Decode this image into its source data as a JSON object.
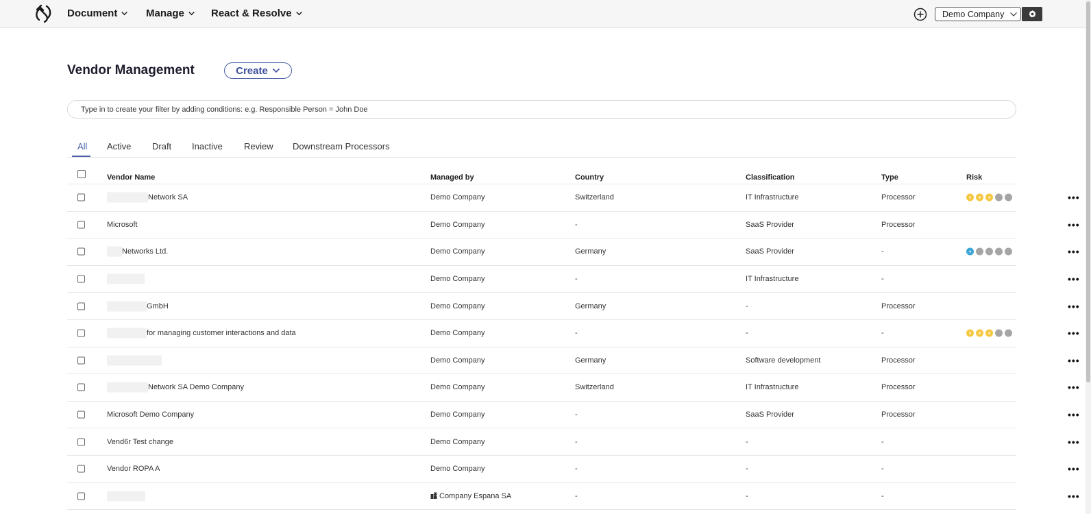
{
  "nav": {
    "items": [
      "Document",
      "Manage",
      "React & Resolve"
    ],
    "company": "Demo Company"
  },
  "page": {
    "title": "Vendor Management",
    "create_label": "Create",
    "filter_placeholder": "Type in to create your filter by adding conditions: e.g. Responsible Person = John Doe"
  },
  "tabs": [
    "All",
    "Active",
    "Draft",
    "Inactive",
    "Review",
    "Downstream Processors"
  ],
  "active_tab": "All",
  "table": {
    "headers": [
      "Vendor Name",
      "Managed by",
      "Country",
      "Classification",
      "Type",
      "Risk"
    ],
    "rows": [
      {
        "name": "Network SA",
        "managed": "Demo Company",
        "country": "Switzerland",
        "classification": "IT Infrastructure",
        "type": "Processor",
        "risk": {
          "level": 3,
          "color": "#f5c842"
        }
      },
      {
        "name": "Microsoft",
        "managed": "Demo Company",
        "country": "-",
        "classification": "SaaS Provider",
        "type": "Processor",
        "risk": null
      },
      {
        "name": "Networks Ltd.",
        "managed": "Demo Company",
        "country": "Germany",
        "classification": "SaaS Provider",
        "type": "-",
        "risk": {
          "level": 1,
          "color": "#3aa6d8"
        }
      },
      {
        "name": "",
        "managed": "Demo Company",
        "country": "-",
        "classification": "IT Infrastructure",
        "type": "-",
        "risk": null
      },
      {
        "name": "GmbH",
        "managed": "Demo Company",
        "country": "Germany",
        "classification": "-",
        "type": "Processor",
        "risk": null
      },
      {
        "name": "for managing customer interactions and data",
        "managed": "Demo Company",
        "country": "-",
        "classification": "-",
        "type": "-",
        "risk": {
          "level": 3,
          "color": "#f5c842"
        }
      },
      {
        "name": "",
        "managed": "Demo Company",
        "country": "Germany",
        "classification": "Software development",
        "type": "Processor",
        "risk": null
      },
      {
        "name": "Network SA Demo Company",
        "managed": "Demo Company",
        "country": "Switzerland",
        "classification": "IT Infrastructure",
        "type": "Processor",
        "risk": null
      },
      {
        "name": "Microsoft Demo Company",
        "managed": "Demo Company",
        "country": "-",
        "classification": "SaaS Provider",
        "type": "Processor",
        "risk": null
      },
      {
        "name": "Vend6r Test change",
        "managed": "Demo Company",
        "country": "-",
        "classification": "-",
        "type": "-",
        "risk": null
      },
      {
        "name": "Vendor ROPA A",
        "managed": "Demo Company",
        "country": "-",
        "classification": "-",
        "type": "-",
        "risk": null
      },
      {
        "name": "",
        "managed": "Company Espana SA",
        "country": "-",
        "classification": "-",
        "type": "-",
        "risk": null
      }
    ]
  }
}
